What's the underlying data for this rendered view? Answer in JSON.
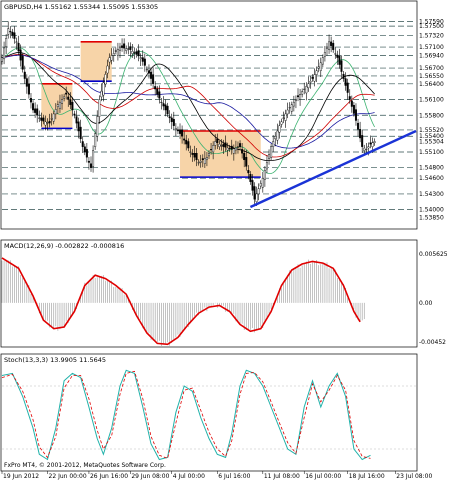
{
  "chart_data": [
    {
      "type": "candlestick",
      "title": "GBPUSD,H4  1.55162 1.55344 1.55095 1.55305",
      "ylim": [
        1.5365,
        1.5775
      ],
      "price_labels": [
        "1.57590",
        "1.57500",
        "1.57320",
        "1.57100",
        "1.56940",
        "1.56700",
        "1.56550",
        "1.56400",
        "1.56100",
        "1.55800",
        "1.55520",
        "1.55400",
        "1.55304",
        "1.55100",
        "1.54800",
        "1.54600",
        "1.54300",
        "1.54000",
        "1.53850"
      ],
      "x_tick_labels": [
        "19 Jun 2012",
        "22 Jun 00:00",
        "26 Jun 16:00",
        "29 Jun 08:00",
        "4 Jul 00:00",
        "6 Jul 16:00",
        "11 Jul 08:00",
        "16 Jul 00:00",
        "18 Jul 16:00",
        "23 Jul 08:00"
      ],
      "close_path": [
        [
          0,
          1.569
        ],
        [
          3,
          1.5745
        ],
        [
          7,
          1.572
        ],
        [
          11,
          1.565
        ],
        [
          15,
          1.559
        ],
        [
          19,
          1.557
        ],
        [
          23,
          1.5565
        ],
        [
          27,
          1.56
        ],
        [
          31,
          1.562
        ],
        [
          35,
          1.558
        ],
        [
          39,
          1.552
        ],
        [
          43,
          1.548
        ],
        [
          47,
          1.561
        ],
        [
          52,
          1.569
        ],
        [
          57,
          1.571
        ],
        [
          62,
          1.5705
        ],
        [
          67,
          1.569
        ],
        [
          71,
          1.566
        ],
        [
          75,
          1.562
        ],
        [
          79,
          1.559
        ],
        [
          83,
          1.556
        ],
        [
          87,
          1.554
        ],
        [
          91,
          1.551
        ],
        [
          95,
          1.549
        ],
        [
          99,
          1.55
        ],
        [
          103,
          1.553
        ],
        [
          107,
          1.552
        ],
        [
          111,
          1.5515
        ],
        [
          115,
          1.552
        ],
        [
          119,
          1.547
        ],
        [
          122,
          1.542
        ],
        [
          126,
          1.546
        ],
        [
          130,
          1.552
        ],
        [
          134,
          1.556
        ],
        [
          138,
          1.559
        ],
        [
          142,
          1.561
        ],
        [
          146,
          1.563
        ],
        [
          150,
          1.565
        ],
        [
          154,
          1.568
        ],
        [
          158,
          1.572
        ],
        [
          162,
          1.569
        ],
        [
          165,
          1.565
        ],
        [
          168,
          1.561
        ],
        [
          171,
          1.557
        ],
        [
          174,
          1.552
        ],
        [
          176,
          1.5515
        ],
        [
          178,
          1.5525
        ],
        [
          180,
          1.553
        ]
      ],
      "boxes": [
        {
          "x0": 19,
          "x1": 34,
          "top": 1.564,
          "bottom": 1.5555
        },
        {
          "x0": 38,
          "x1": 53,
          "top": 1.572,
          "bottom": 1.5645
        },
        {
          "x0": 86,
          "x1": 125,
          "top": 1.555,
          "bottom": 1.5462
        }
      ],
      "trendline": [
        [
          120,
          1.5405
        ],
        [
          200,
          1.555
        ]
      ],
      "horizontal_levels": [
        1.5759,
        1.575,
        1.5732,
        1.571,
        1.5694,
        1.567,
        1.5655,
        1.564,
        1.561,
        1.558,
        1.5552,
        1.554,
        1.551,
        1.548,
        1.546,
        1.543,
        1.54
      ]
    },
    {
      "type": "macd",
      "title": "MACD(12,26,9) -0.002822 -0.000816",
      "ylim": [
        -0.005,
        0.006
      ],
      "y_tick_labels": [
        "0.005625",
        "0.00",
        "-0.00452"
      ],
      "signal_line": [
        [
          0,
          0.0052
        ],
        [
          8,
          0.004
        ],
        [
          15,
          0.0008
        ],
        [
          20,
          -0.002
        ],
        [
          25,
          -0.003
        ],
        [
          30,
          -0.0028
        ],
        [
          35,
          -0.001
        ],
        [
          40,
          0.002
        ],
        [
          45,
          0.0032
        ],
        [
          50,
          0.0028
        ],
        [
          55,
          0.002
        ],
        [
          60,
          0.001
        ],
        [
          65,
          -0.0015
        ],
        [
          70,
          -0.0035
        ],
        [
          75,
          -0.0047
        ],
        [
          80,
          -0.0048
        ],
        [
          85,
          -0.004
        ],
        [
          90,
          -0.0025
        ],
        [
          95,
          -0.0012
        ],
        [
          100,
          -0.0005
        ],
        [
          105,
          -0.0003
        ],
        [
          110,
          -0.001
        ],
        [
          115,
          -0.0025
        ],
        [
          120,
          -0.0033
        ],
        [
          125,
          -0.003
        ],
        [
          130,
          -0.001
        ],
        [
          135,
          0.002
        ],
        [
          140,
          0.0038
        ],
        [
          145,
          0.0045
        ],
        [
          150,
          0.0048
        ],
        [
          155,
          0.0046
        ],
        [
          160,
          0.004
        ],
        [
          165,
          0.002
        ],
        [
          170,
          -0.001
        ],
        [
          173,
          -0.0022
        ]
      ]
    },
    {
      "type": "stochastic",
      "title": "Stoch(13,3,3) 13.9905 11.5645",
      "ylim": [
        0,
        100
      ],
      "main": [
        [
          0,
          90
        ],
        [
          5,
          92
        ],
        [
          10,
          70
        ],
        [
          15,
          40
        ],
        [
          18,
          15
        ],
        [
          22,
          10
        ],
        [
          26,
          40
        ],
        [
          30,
          85
        ],
        [
          34,
          92
        ],
        [
          38,
          88
        ],
        [
          42,
          60
        ],
        [
          46,
          30
        ],
        [
          49,
          15
        ],
        [
          53,
          40
        ],
        [
          57,
          80
        ],
        [
          60,
          95
        ],
        [
          64,
          92
        ],
        [
          68,
          60
        ],
        [
          72,
          25
        ],
        [
          76,
          10
        ],
        [
          80,
          12
        ],
        [
          84,
          55
        ],
        [
          88,
          80
        ],
        [
          92,
          75
        ],
        [
          96,
          50
        ],
        [
          100,
          30
        ],
        [
          104,
          15
        ],
        [
          108,
          12
        ],
        [
          111,
          35
        ],
        [
          115,
          80
        ],
        [
          118,
          95
        ],
        [
          122,
          92
        ],
        [
          126,
          80
        ],
        [
          130,
          60
        ],
        [
          134,
          40
        ],
        [
          138,
          20
        ],
        [
          142,
          15
        ],
        [
          146,
          60
        ],
        [
          150,
          85
        ],
        [
          154,
          60
        ],
        [
          158,
          80
        ],
        [
          162,
          92
        ],
        [
          166,
          70
        ],
        [
          170,
          20
        ],
        [
          174,
          10
        ],
        [
          178,
          14
        ]
      ],
      "signal": [
        [
          0,
          88
        ],
        [
          5,
          91
        ],
        [
          10,
          75
        ],
        [
          15,
          48
        ],
        [
          18,
          22
        ],
        [
          22,
          12
        ],
        [
          26,
          32
        ],
        [
          30,
          78
        ],
        [
          34,
          90
        ],
        [
          38,
          90
        ],
        [
          42,
          68
        ],
        [
          46,
          38
        ],
        [
          49,
          20
        ],
        [
          53,
          33
        ],
        [
          57,
          72
        ],
        [
          60,
          92
        ],
        [
          64,
          94
        ],
        [
          68,
          68
        ],
        [
          72,
          32
        ],
        [
          76,
          14
        ],
        [
          80,
          11
        ],
        [
          84,
          45
        ],
        [
          88,
          76
        ],
        [
          92,
          78
        ],
        [
          96,
          57
        ],
        [
          100,
          36
        ],
        [
          104,
          20
        ],
        [
          108,
          13
        ],
        [
          111,
          28
        ],
        [
          115,
          72
        ],
        [
          118,
          92
        ],
        [
          122,
          93
        ],
        [
          126,
          84
        ],
        [
          130,
          65
        ],
        [
          134,
          45
        ],
        [
          138,
          26
        ],
        [
          142,
          16
        ],
        [
          146,
          50
        ],
        [
          150,
          82
        ],
        [
          154,
          65
        ],
        [
          158,
          76
        ],
        [
          162,
          90
        ],
        [
          166,
          76
        ],
        [
          170,
          28
        ],
        [
          174,
          13
        ],
        [
          178,
          11
        ]
      ]
    }
  ],
  "footer": "FxPro MT4, © 2001-2012, MetaQuotes Software Corp."
}
